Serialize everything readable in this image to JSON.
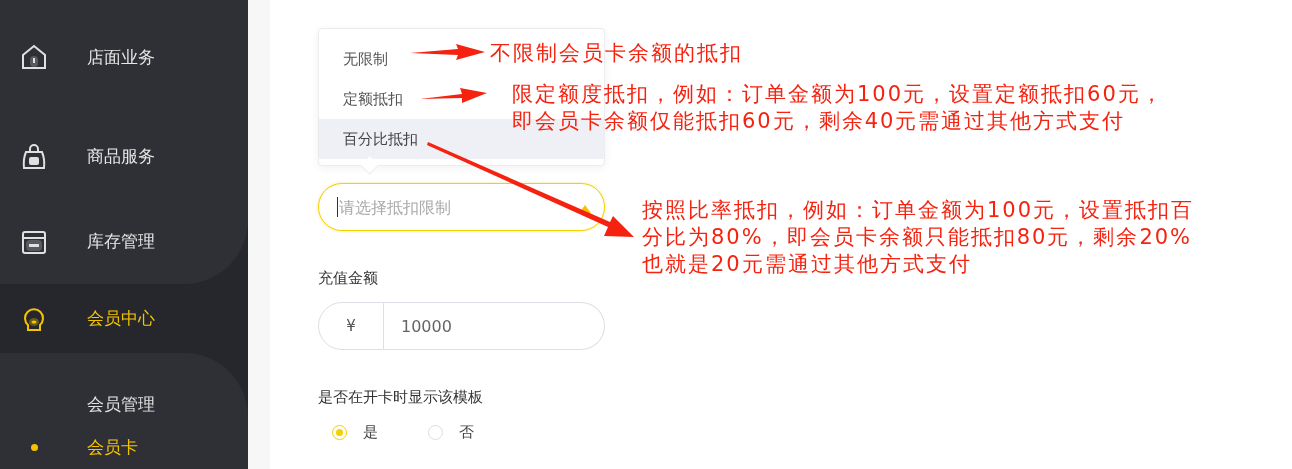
{
  "sidebar": {
    "items": [
      {
        "label": "店面业务",
        "selected": false
      },
      {
        "label": "商品服务",
        "selected": false
      },
      {
        "label": "库存管理",
        "selected": false
      },
      {
        "label": "会员中心",
        "selected": true
      }
    ],
    "sub_items": [
      {
        "label": "会员管理",
        "selected": false
      },
      {
        "label": "会员卡",
        "selected": true
      }
    ]
  },
  "dropdown": {
    "options": [
      {
        "label": "无限制",
        "selected": false
      },
      {
        "label": "定额抵扣",
        "selected": false
      },
      {
        "label": "百分比抵扣",
        "selected": true
      }
    ]
  },
  "deduction_select": {
    "placeholder": "请选择抵扣限制"
  },
  "amount": {
    "label": "充值金额",
    "prefix": "¥",
    "value": "10000"
  },
  "show_on_open": {
    "label": "是否在开卡时显示该模板",
    "options": [
      {
        "label": "是",
        "selected": true
      },
      {
        "label": "否",
        "selected": false
      }
    ]
  },
  "annotations": [
    "不限制会员卡余额的抵扣",
    "限定额度抵扣，例如：订单金额为100元，设置定额抵扣60元，即会员卡余额仅能抵扣60元，剩余40元需通过其他方式支付",
    "按照比率抵扣，例如：订单金额为100元，设置抵扣百分比为80%，即会员卡余额只能抵扣80元，剩余20%也就是20元需通过其他方式支付"
  ]
}
